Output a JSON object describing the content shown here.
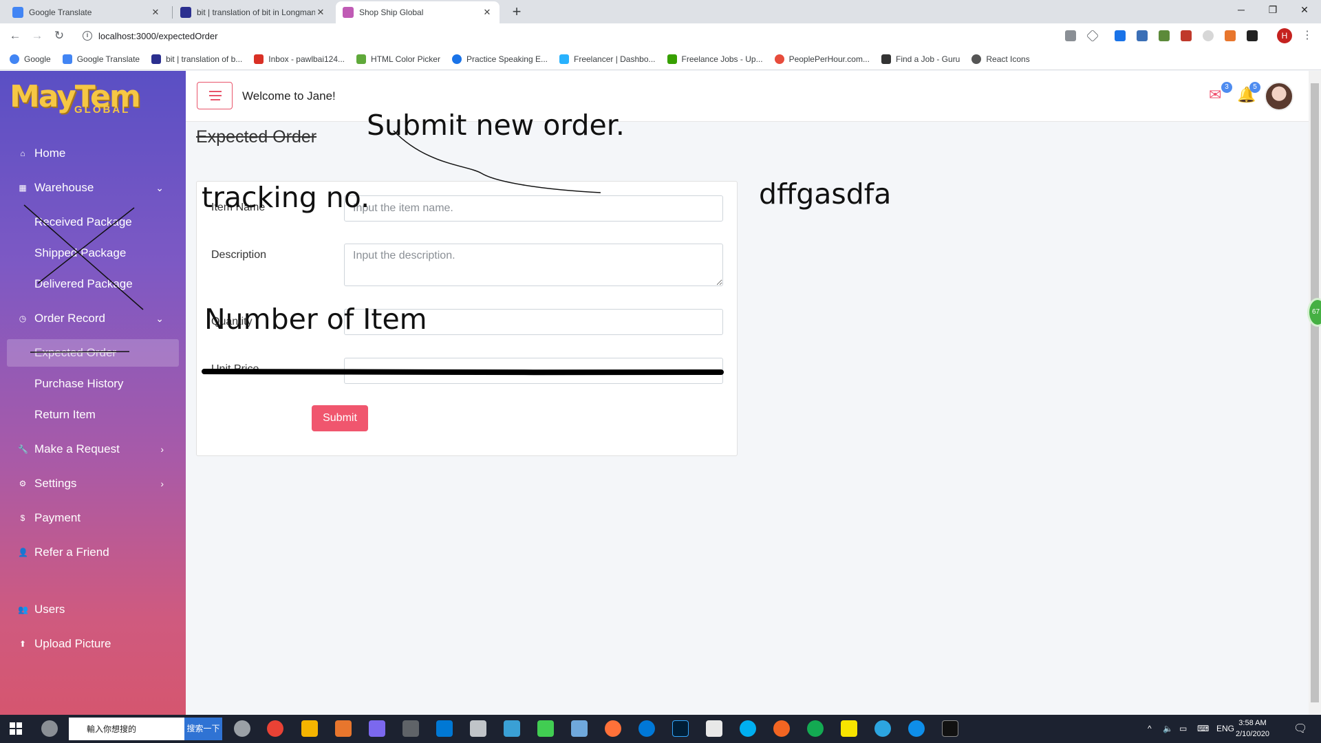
{
  "browser": {
    "tabs": [
      {
        "title": "Google Translate",
        "close": "✕"
      },
      {
        "title": "bit | translation of bit in Longman",
        "close": "✕"
      },
      {
        "title": "Shop Ship Global",
        "close": "✕"
      }
    ],
    "new_tab": "+",
    "window_controls": {
      "minimize": "─",
      "restore": "❐",
      "close": "✕"
    },
    "nav": {
      "back": "←",
      "forward": "→",
      "reload": "↻"
    },
    "url": "localhost:3000/expectedOrder",
    "profile_initial": "H",
    "bookmarks": [
      "Google",
      "Google Translate",
      "bit | translation of b...",
      "Inbox - pawlbai124...",
      "HTML Color Picker",
      "Practice Speaking E...",
      "Freelancer | Dashbo...",
      "Freelance Jobs - Up...",
      "PeoplePerHour.com...",
      "Find a Job - Guru",
      "React Icons"
    ]
  },
  "sidebar": {
    "logo_text": "MayTem",
    "logo_sub": "GLOBAL",
    "items": [
      {
        "label": "Home",
        "icon": "home-icon"
      },
      {
        "label": "Warehouse",
        "icon": "warehouse-icon"
      },
      {
        "label": "Received Package"
      },
      {
        "label": "Shipped Package"
      },
      {
        "label": "Delivered Package"
      },
      {
        "label": "Order Record",
        "icon": "history-icon"
      },
      {
        "label": "Expected Order"
      },
      {
        "label": "Purchase History"
      },
      {
        "label": "Return Item"
      },
      {
        "label": "Make a Request",
        "icon": "wrench-icon"
      },
      {
        "label": "Settings",
        "icon": "gear-icon"
      },
      {
        "label": "Payment",
        "icon": "dollar-icon"
      },
      {
        "label": "Refer a Friend",
        "icon": "user-add-icon"
      },
      {
        "label": "Users",
        "icon": "users-icon"
      },
      {
        "label": "Upload Picture",
        "icon": "upload-icon"
      }
    ]
  },
  "header": {
    "welcome": "Welcome to Jane!",
    "mail_count": "3",
    "notification_count": "5"
  },
  "page": {
    "title": "Expected Order",
    "form": {
      "item_name_label": "Item Name",
      "item_name_placeholder": "Input the item name.",
      "description_label": "Description",
      "description_placeholder": "Input the description.",
      "quantity_label": "Quantity",
      "unit_price_label": "Unit Price",
      "submit_label": "Submit"
    }
  },
  "annotations": {
    "submit_note": "Submit new order.",
    "tracking_note": "tracking no.",
    "number_note": "Number of Item",
    "side_note": "dffgasdfa"
  },
  "scroll_widget": "67",
  "taskbar": {
    "search_placeholder": "輸入你想搜的",
    "search_button": "搜索一下",
    "lang": "ENG",
    "time": "3:58 AM",
    "date": "2/10/2020"
  }
}
